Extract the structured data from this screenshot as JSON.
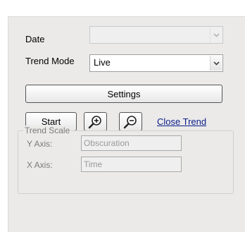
{
  "form": {
    "date_label": "Date",
    "date_value": "",
    "trend_mode_label": "Trend Mode",
    "trend_mode_value": "Live",
    "settings_label": "Settings",
    "start_label": "Start",
    "close_trend_label": "Close Trend"
  },
  "trend_scale": {
    "title": "Trend Scale",
    "y_axis_label": "Y Axis:",
    "y_axis_value": "Obscuration",
    "x_axis_label": "X Axis:",
    "x_axis_value": "Time"
  },
  "icons": {
    "dropdown": "chevron-down-icon",
    "zoom_in": "zoom-in-icon",
    "zoom_out": "zoom-out-icon"
  },
  "colors": {
    "panel_bg": "#ebeae9",
    "link": "#0b1e8a"
  }
}
